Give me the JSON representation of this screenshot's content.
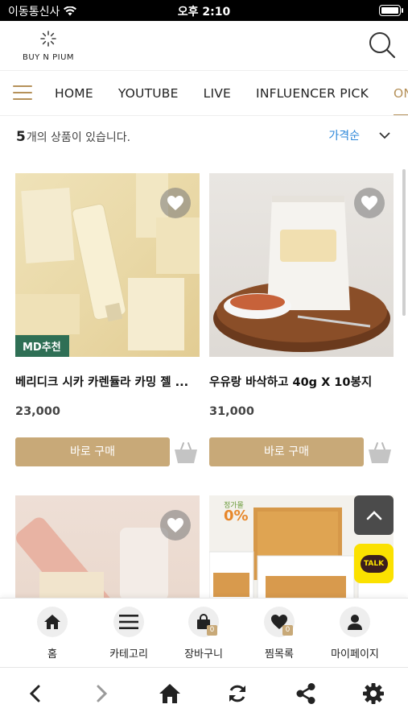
{
  "status_bar": {
    "carrier": "이동통신사",
    "time": "오후 2:10"
  },
  "header": {
    "logo_text": "BUY N PIUM"
  },
  "nav": {
    "tabs": [
      {
        "label": "HOME"
      },
      {
        "label": "YOUTUBE"
      },
      {
        "label": "LIVE"
      },
      {
        "label": "INFLUENCER PICK"
      },
      {
        "label": "ONLY"
      }
    ]
  },
  "results": {
    "count": "5",
    "suffix": "개의 상품이 있습니다.",
    "sort_label": "가격순"
  },
  "products": [
    {
      "name": "베리디크 시카 카렌듈라 카밍 젤 ...",
      "price": "23,000",
      "badge": "MD추천",
      "buy_label": "바로 구매"
    },
    {
      "name": "우유랑 바삭하고 40g X 10봉지",
      "price": "31,000",
      "buy_label": "바로 구매",
      "pack_text": "우유랑 바삭하고"
    },
    {
      "name": "",
      "price": ""
    },
    {
      "name": "",
      "price": "",
      "promo_text": "정가몰",
      "promo_value": "0%"
    }
  ],
  "bottom_menu": [
    {
      "label": "홈",
      "icon": "home-icon"
    },
    {
      "label": "카테고리",
      "icon": "menu-icon"
    },
    {
      "label": "장바구니",
      "icon": "cart-icon",
      "badge": "0"
    },
    {
      "label": "찜목록",
      "icon": "heart-icon",
      "badge": "0"
    },
    {
      "label": "마이페이지",
      "icon": "user-icon"
    }
  ],
  "floating": {
    "talk_label": "TALK"
  },
  "colors": {
    "accent": "#c8a978",
    "nav_active": "#b5915a",
    "sort_blue": "#2a86d9",
    "badge_green": "#2f6f55",
    "talk_yellow": "#fbe100"
  }
}
